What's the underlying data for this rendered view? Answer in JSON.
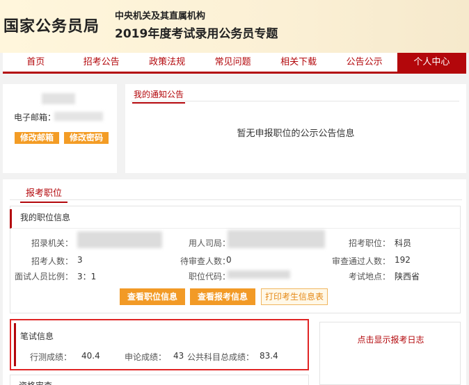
{
  "header": {
    "site_title": "国家公务员局",
    "subtitle_1": "中央机关及其直属机构",
    "subtitle_2": "2019年度考试录用公务员专题"
  },
  "nav": {
    "items": [
      "首页",
      "招考公告",
      "政策法规",
      "常见问题",
      "相关下载",
      "公告公示",
      "个人中心"
    ],
    "active_index": 6
  },
  "user": {
    "email_label": "电子邮箱：",
    "edit_email_button": "修改邮箱",
    "edit_password_button": "修改密码"
  },
  "notice": {
    "tab_label": "我的通知公告",
    "empty_text": "暂无申报职位的公示公告信息"
  },
  "main": {
    "tab_label": "报考职位",
    "job_info": {
      "title": "我的职位信息",
      "labels": {
        "agency": "招录机关：",
        "bureau": "用人司局：",
        "position": "招考职位：",
        "recruit_count": "招考人数：",
        "pending_count": "待审查人数：",
        "passed_count": "审查通过人数：",
        "interview_ratio": "面试人员比例：",
        "position_code": "职位代码：",
        "exam_location": "考试地点："
      },
      "values": {
        "position": "科员",
        "recruit_count": "3",
        "pending_count": "0",
        "passed_count": "192",
        "interview_ratio": "3：1",
        "exam_location": "陕西省"
      },
      "buttons": {
        "view_position": "查看职位信息",
        "view_application": "查看报考信息",
        "print_info": "打印考生信息表"
      }
    },
    "written_exam": {
      "title": "笔试信息",
      "xingce_label": "行测成绩：",
      "xingce_value": "40.4",
      "shenlun_label": "申论成绩：",
      "shenlun_value": "43",
      "total_label": "公共科目总成绩：",
      "total_value": "83.4"
    },
    "log_link": "点击显示报考日志",
    "next_section_title": "资格审查"
  },
  "colors": {
    "brand_red": "#b3070b",
    "orange": "#f39c25",
    "highlight_red": "#e02424"
  }
}
